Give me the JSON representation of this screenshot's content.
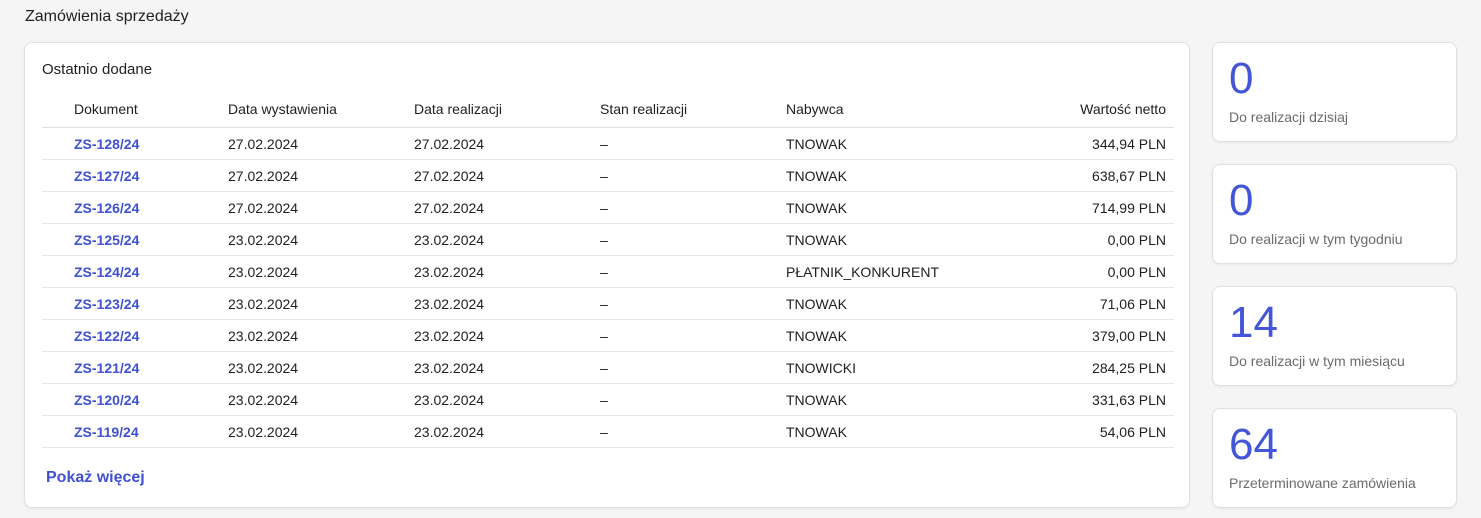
{
  "page": {
    "title": "Zamówienia sprzedaży"
  },
  "orders": {
    "title": "Ostatnio dodane",
    "columns": [
      "Dokument",
      "Data wystawienia",
      "Data realizacji",
      "Stan realizacji",
      "Nabywca",
      "Wartość netto"
    ],
    "rows": [
      [
        "ZS-128/24",
        "27.02.2024",
        "27.02.2024",
        "–",
        "TNOWAK",
        "344,94 PLN"
      ],
      [
        "ZS-127/24",
        "27.02.2024",
        "27.02.2024",
        "–",
        "TNOWAK",
        "638,67 PLN"
      ],
      [
        "ZS-126/24",
        "27.02.2024",
        "27.02.2024",
        "–",
        "TNOWAK",
        "714,99 PLN"
      ],
      [
        "ZS-125/24",
        "23.02.2024",
        "23.02.2024",
        "–",
        "TNOWAK",
        "0,00 PLN"
      ],
      [
        "ZS-124/24",
        "23.02.2024",
        "23.02.2024",
        "–",
        "PŁATNIK_KONKURENT",
        "0,00 PLN"
      ],
      [
        "ZS-123/24",
        "23.02.2024",
        "23.02.2024",
        "–",
        "TNOWAK",
        "71,06 PLN"
      ],
      [
        "ZS-122/24",
        "23.02.2024",
        "23.02.2024",
        "–",
        "TNOWAK",
        "379,00 PLN"
      ],
      [
        "ZS-121/24",
        "23.02.2024",
        "23.02.2024",
        "–",
        "TNOWICKI",
        "284,25 PLN"
      ],
      [
        "ZS-120/24",
        "23.02.2024",
        "23.02.2024",
        "–",
        "TNOWAK",
        "331,63 PLN"
      ],
      [
        "ZS-119/24",
        "23.02.2024",
        "23.02.2024",
        "–",
        "TNOWAK",
        "54,06 PLN"
      ]
    ],
    "show_more": "Pokaż więcej"
  },
  "stats": [
    {
      "value": "0",
      "label": "Do realizacji dzisiaj"
    },
    {
      "value": "0",
      "label": "Do realizacji w tym tygodniu"
    },
    {
      "value": "14",
      "label": "Do realizacji w tym miesiącu"
    },
    {
      "value": "64",
      "label": "Przeterminowane zamówienia"
    }
  ],
  "colors": {
    "accent": "#4355d9",
    "link": "#3f51d1",
    "background": "#f5f5f6"
  }
}
